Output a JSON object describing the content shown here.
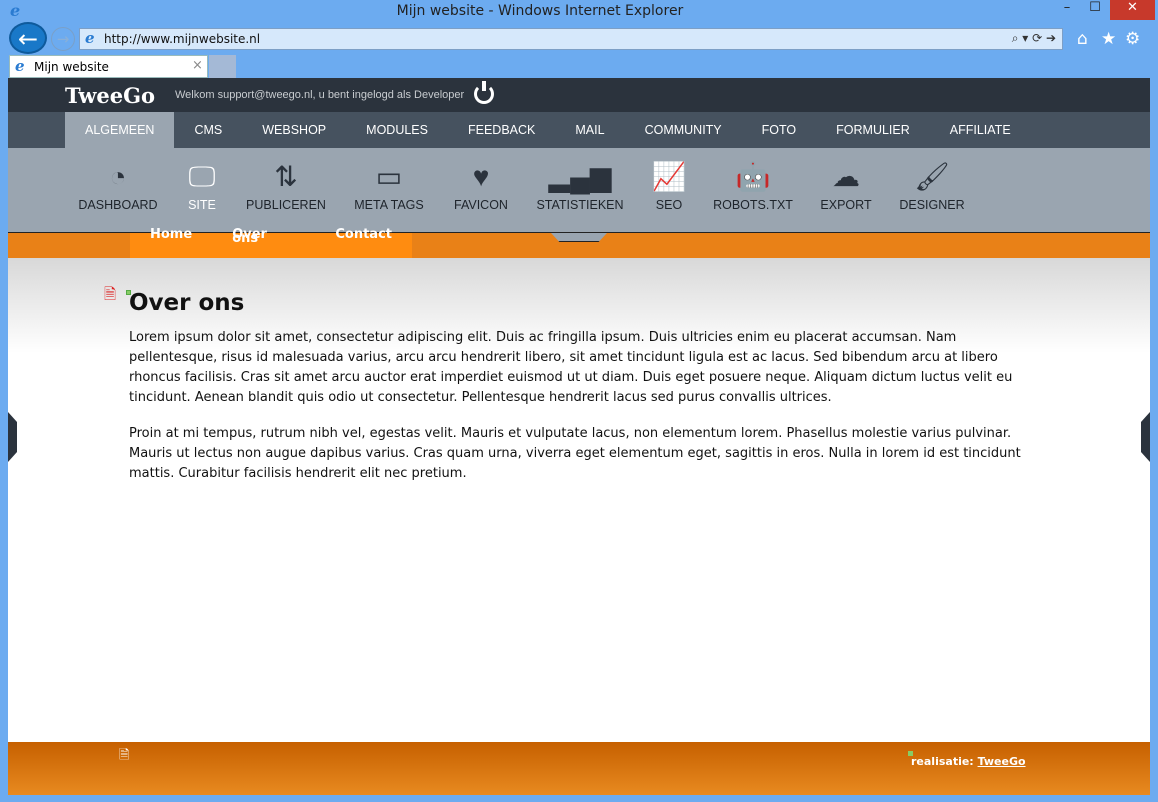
{
  "browser": {
    "title": "Mijn website - Windows Internet Explorer",
    "url": "http://www.mijnwebsite.nl",
    "tab_label": "Mijn website",
    "window_buttons": {
      "minimize": "–",
      "maximize": "☐",
      "close": "✕"
    }
  },
  "header": {
    "logo": "TweeGo",
    "welcome": "Welkom support@tweego.nl, u bent ingelogd als Developer"
  },
  "nav": {
    "items": [
      {
        "label": "ALGEMEEN",
        "active": true
      },
      {
        "label": "CMS"
      },
      {
        "label": "WEBSHOP"
      },
      {
        "label": "MODULES"
      },
      {
        "label": "FEEDBACK"
      },
      {
        "label": "MAIL"
      },
      {
        "label": "COMMUNITY"
      },
      {
        "label": "FOTO"
      },
      {
        "label": "FORMULIER"
      },
      {
        "label": "AFFILIATE"
      }
    ]
  },
  "tools": {
    "items": [
      {
        "label": "DASHBOARD",
        "icon": "dashboard-icon",
        "glyph": "◔"
      },
      {
        "label": "SITE",
        "icon": "monitor-icon",
        "glyph": "🖵",
        "active": true
      },
      {
        "label": "PUBLICEREN",
        "icon": "up-down-arrows-icon",
        "glyph": "⇅"
      },
      {
        "label": "META TAGS",
        "icon": "meta-tags-icon",
        "glyph": "▭"
      },
      {
        "label": "FAVICON",
        "icon": "heart-icon",
        "glyph": "♥"
      },
      {
        "label": "STATISTIEKEN",
        "icon": "bar-chart-icon",
        "glyph": "▂▄▆"
      },
      {
        "label": "SEO",
        "icon": "line-chart-icon",
        "glyph": "📈"
      },
      {
        "label": "ROBOTS.TXT",
        "icon": "robot-icon",
        "glyph": "🤖"
      },
      {
        "label": "EXPORT",
        "icon": "cloud-upload-icon",
        "glyph": "☁"
      },
      {
        "label": "DESIGNER",
        "icon": "brush-icon",
        "glyph": "🖌"
      }
    ]
  },
  "site_menu": {
    "items": [
      "Home",
      "Over ons",
      "Contact"
    ]
  },
  "content": {
    "title": "Over ons",
    "paragraphs": [
      "Lorem ipsum dolor sit amet, consectetur adipiscing elit. Duis ac fringilla ipsum. Duis ultricies enim eu placerat accumsan. Nam pellentesque, risus id malesuada varius, arcu arcu hendrerit libero, sit amet tincidunt ligula est ac lacus. Sed bibendum arcu at libero rhoncus facilisis. Cras sit amet arcu auctor erat imperdiet euismod ut ut diam. Duis eget posuere neque. Aliquam dictum luctus velit eu tincidunt. Aenean blandit quis odio ut consectetur. Pellentesque hendrerit lacus sed purus convallis ultrices.",
      "Proin at mi tempus, rutrum nibh vel, egestas velit. Mauris et vulputate lacus, non elementum lorem. Phasellus molestie varius pulvinar. Mauris ut lectus non augue dapibus varius. Cras quam urna, viverra eget elementum eget, sagittis in eros. Nulla in lorem id est tincidunt mattis. Curabitur facilisis hendrerit elit nec pretium."
    ]
  },
  "footer": {
    "credit_prefix": "realisatie:",
    "credit_link": "TweeGo"
  }
}
